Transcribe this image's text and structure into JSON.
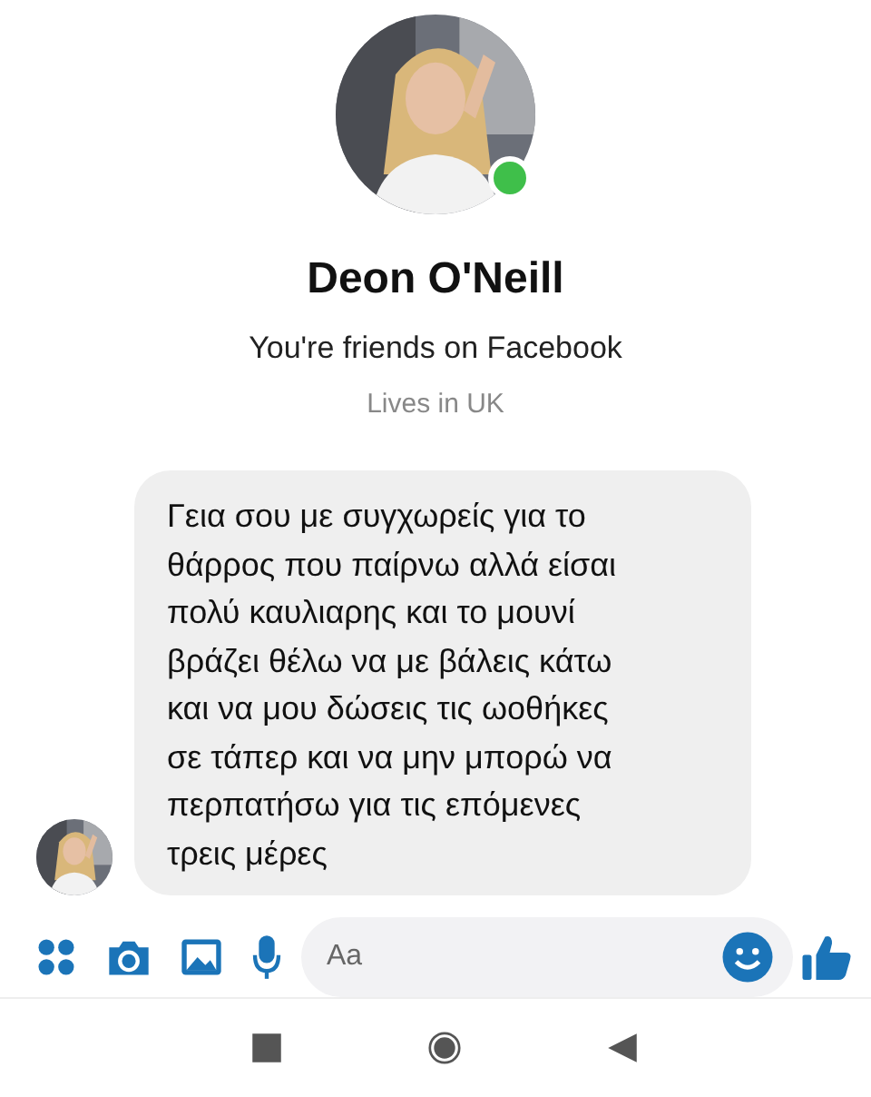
{
  "profile": {
    "name": "Deon O'Neill",
    "online": true,
    "friendship": "You're friends on Facebook",
    "location": "Lives in UK"
  },
  "messages": [
    {
      "text": "Γεια σου με συγχωρείς για το\nθάρρος που παίρνω αλλά είσαι\nπολύ καυλιαρης και το μουνί\nβράζει θέλω να με βάλεις κάτω\nκαι να μου δώσεις τις ωοθήκες\nσε τάπερ και να μην μπορώ να\nπερπατήσω για τις επόμενες\nτρεις μέρες"
    }
  ],
  "composer": {
    "placeholder": "Aa"
  }
}
